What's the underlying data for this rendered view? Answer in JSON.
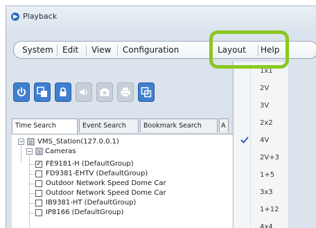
{
  "window": {
    "title": "Playback",
    "icon": "playback-app-icon"
  },
  "menubar": {
    "items": [
      {
        "label": "System"
      },
      {
        "label": "Edit"
      },
      {
        "label": "View"
      },
      {
        "label": "Configuration"
      },
      {
        "label": "Layout"
      },
      {
        "label": "Help"
      }
    ]
  },
  "toolbar": {
    "buttons": [
      {
        "icon": "power-icon",
        "enabled": true
      },
      {
        "icon": "camera-swap-icon",
        "enabled": true
      },
      {
        "icon": "lock-icon",
        "enabled": true
      },
      {
        "icon": "audio-icon",
        "enabled": false
      },
      {
        "icon": "snapshot-icon",
        "enabled": false
      },
      {
        "icon": "print-icon",
        "enabled": false
      },
      {
        "icon": "export-icon",
        "enabled": true
      }
    ]
  },
  "tabs": [
    {
      "label": "Time Search",
      "active": true
    },
    {
      "label": "Event Search",
      "active": false
    },
    {
      "label": "Bookmark Search",
      "active": false
    },
    {
      "label": "A",
      "active": false
    }
  ],
  "tree": {
    "root": "VMS_Station(127.0.0.1)",
    "group": "Cameras",
    "cameras": [
      {
        "label": "FE9181-H (DefaultGroup)",
        "checked": true
      },
      {
        "label": "FD9381-EHTV (DefaultGroup)",
        "checked": false
      },
      {
        "label": "Outdoor Network Speed Dome Car",
        "checked": false
      },
      {
        "label": "Outdoor Network Speed Dome Car",
        "checked": false
      },
      {
        "label": "IB9381-HT (DefaultGroup)",
        "checked": false
      },
      {
        "label": "IP8166 (DefaultGroup)",
        "checked": false
      }
    ]
  },
  "layout_menu": {
    "items": [
      "1x1",
      "2V",
      "3V",
      "2x2",
      "4V",
      "2V+3",
      "1+5",
      "3x3",
      "1+12",
      "4x4"
    ],
    "selected": "4V",
    "check_icon": "checkmark-icon"
  },
  "colors": {
    "highlight": "#8ac820",
    "button_blue": "#3f7fd0",
    "check_blue": "#2b5fb3"
  }
}
